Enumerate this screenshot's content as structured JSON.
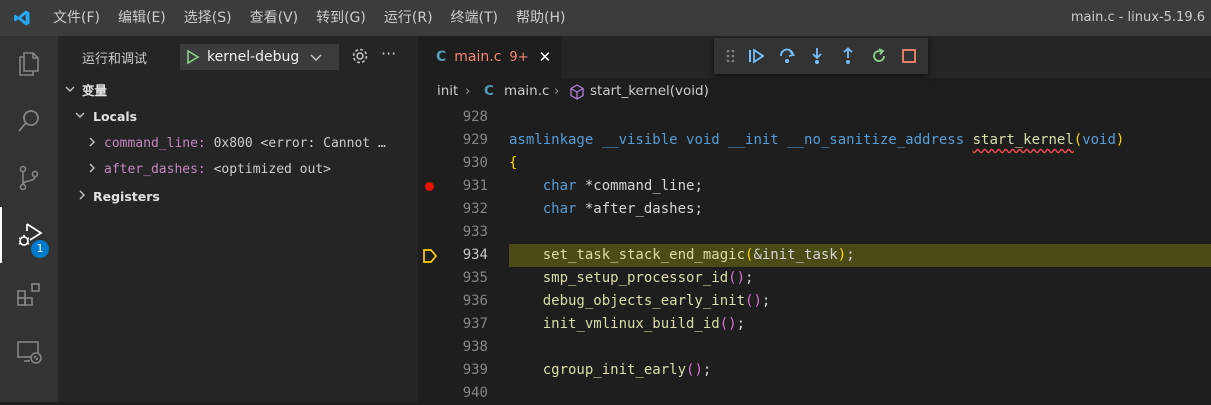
{
  "titlebar": {
    "menu": [
      "文件(F)",
      "编辑(E)",
      "选择(S)",
      "查看(V)",
      "转到(G)",
      "运行(R)",
      "终端(T)",
      "帮助(H)"
    ],
    "window_title": "main.c - linux-5.19.6"
  },
  "activity": {
    "debug_badge": "1"
  },
  "sidebar": {
    "title": "运行和调试",
    "launch_config": "kernel-debug",
    "variables_label": "变量",
    "locals_label": "Locals",
    "variables": [
      {
        "name": "command_line:",
        "value": "0x800 <error: Cannot …"
      },
      {
        "name": "after_dashes:",
        "value": "<optimized out>"
      }
    ],
    "registers_label": "Registers"
  },
  "editor": {
    "tab": {
      "lang": "C",
      "name": "main.c",
      "problems": "9+"
    },
    "breadcrumb": {
      "folder": "init",
      "file_lang": "C",
      "file": "main.c",
      "symbol": "start_kernel(void)"
    },
    "line_numbers": [
      "928",
      "929",
      "930",
      "931",
      "932",
      "933",
      "934",
      "935",
      "936",
      "937",
      "938",
      "939",
      "940"
    ],
    "current_line": "934",
    "breakpoint_line": "931",
    "code": {
      "l929_modifiers": "asmlinkage __visible ",
      "l929_void": "void",
      "l929_init": " __init __no_sanitize_address ",
      "l929_fn": "start_kernel",
      "l929_param": "void",
      "l930": "{",
      "l931_type": "char",
      "l931_rest": " *command_line;",
      "l932_type": "char",
      "l932_rest": " *after_dashes;",
      "l934_fn": "set_task_stack_end_magic",
      "l934_arg": "&init_task",
      "l935_fn": "smp_setup_processor_id",
      "l936_fn": "debug_objects_early_init",
      "l937_fn": "init_vmlinux_build_id",
      "l939_fn": "cgroup_init_early"
    }
  },
  "colors": {
    "accent": "#007acc",
    "breakpoint": "#e51400",
    "current_line_bg": "#4b4b18",
    "debug_green": "#89d185"
  }
}
